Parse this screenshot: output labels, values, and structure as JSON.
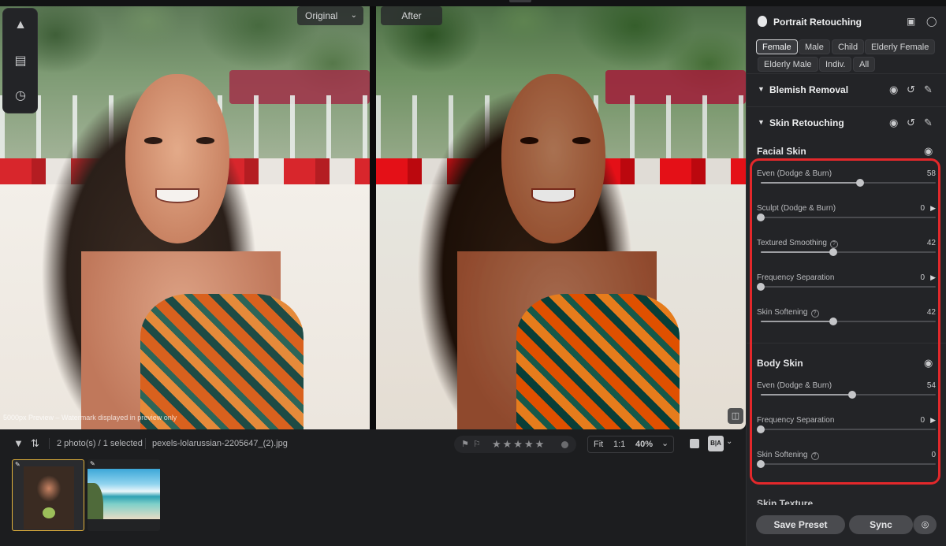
{
  "preview": {
    "original_label": "Original",
    "after_label": "After",
    "watermark": "5000px Preview – Watermark displayed in preview only",
    "tools": [
      "landscape-tool-icon",
      "texture-tool-icon",
      "history-icon"
    ]
  },
  "filmstrip": {
    "count_text": "2 photo(s) / 1 selected",
    "filename": "pexels-lolarussian-2205647_(2).jpg",
    "rating_stars": "★★★★★",
    "zoom": {
      "fit": "Fit",
      "one": "1:1",
      "percent": "40%"
    },
    "view_ba": "B|A",
    "thumbnails": [
      {
        "name": "portrait-beach",
        "selected": true
      },
      {
        "name": "beach-landscape",
        "selected": false
      }
    ]
  },
  "panel": {
    "title": "Portrait Retouching",
    "chips": [
      "Female",
      "Male",
      "Child",
      "Elderly Female",
      "Elderly Male",
      "Indiv.",
      "All"
    ],
    "active_chip": "Female",
    "sections": {
      "blemish": "Blemish Removal",
      "skin": "Skin Retouching",
      "texture": "Skin Texture"
    },
    "facial": {
      "title": "Facial Skin",
      "sliders": [
        {
          "label": "Even (Dodge & Burn)",
          "value": "58",
          "arrow": false,
          "help": false
        },
        {
          "label": "Sculpt (Dodge & Burn)",
          "value": "0",
          "arrow": true,
          "help": false
        },
        {
          "label": "Textured Smoothing",
          "value": "42",
          "arrow": false,
          "help": true
        },
        {
          "label": "Frequency Separation",
          "value": "0",
          "arrow": true,
          "help": false
        },
        {
          "label": "Skin Softening",
          "value": "42",
          "arrow": false,
          "help": true
        }
      ]
    },
    "body": {
      "title": "Body Skin",
      "sliders": [
        {
          "label": "Even (Dodge & Burn)",
          "value": "54",
          "arrow": false,
          "help": false
        },
        {
          "label": "Frequency Separation",
          "value": "0",
          "arrow": true,
          "help": false
        },
        {
          "label": "Skin Softening",
          "value": "0",
          "arrow": false,
          "help": true
        }
      ]
    },
    "buttons": {
      "save": "Save Preset",
      "sync": "Sync"
    }
  },
  "colors": {
    "highlight": "#e3282b",
    "selection": "#e3b33c",
    "panel_bg": "#232427"
  }
}
